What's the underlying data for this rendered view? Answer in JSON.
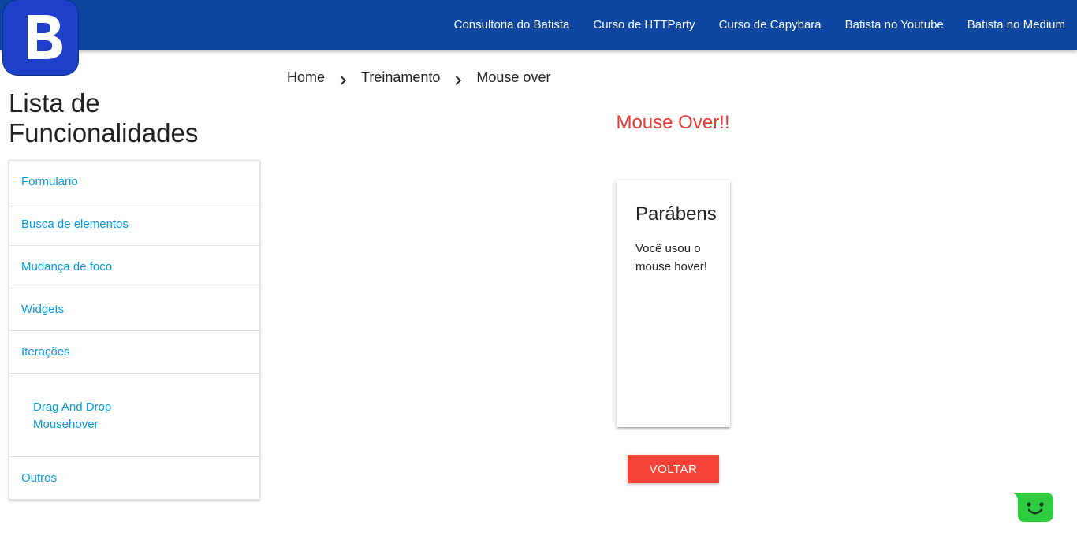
{
  "header": {
    "logo_letter": "B",
    "brand_color": "#0d47a1",
    "nav": [
      {
        "label": "Consultoria do Batista"
      },
      {
        "label": "Curso de HTTParty"
      },
      {
        "label": "Curso de Capybara"
      },
      {
        "label": "Batista no Youtube"
      },
      {
        "label": "Batista no Medium"
      }
    ]
  },
  "sidebar": {
    "title": "Lista de Funcionalidades",
    "items": [
      {
        "label": "Formulário"
      },
      {
        "label": "Busca de elementos"
      },
      {
        "label": "Mudança de foco"
      },
      {
        "label": "Widgets"
      },
      {
        "label": "Iterações"
      }
    ],
    "subitems": [
      {
        "label": "Drag And Drop"
      },
      {
        "label": "Mousehover"
      }
    ],
    "last_item": {
      "label": "Outros"
    },
    "link_color": "#039be5"
  },
  "breadcrumb": [
    {
      "label": "Home"
    },
    {
      "label": "Treinamento"
    },
    {
      "label": "Mouse over"
    }
  ],
  "main": {
    "heading": "Mouse Over!!",
    "heading_color": "#e53935",
    "card": {
      "title": "Parábens",
      "text": "Você usou o mouse hover!"
    },
    "back_button": "VOLTAR",
    "back_button_color": "#f44336"
  },
  "chat_widget": {
    "icon": "chat-smile-icon",
    "color": "#2ecc40"
  }
}
